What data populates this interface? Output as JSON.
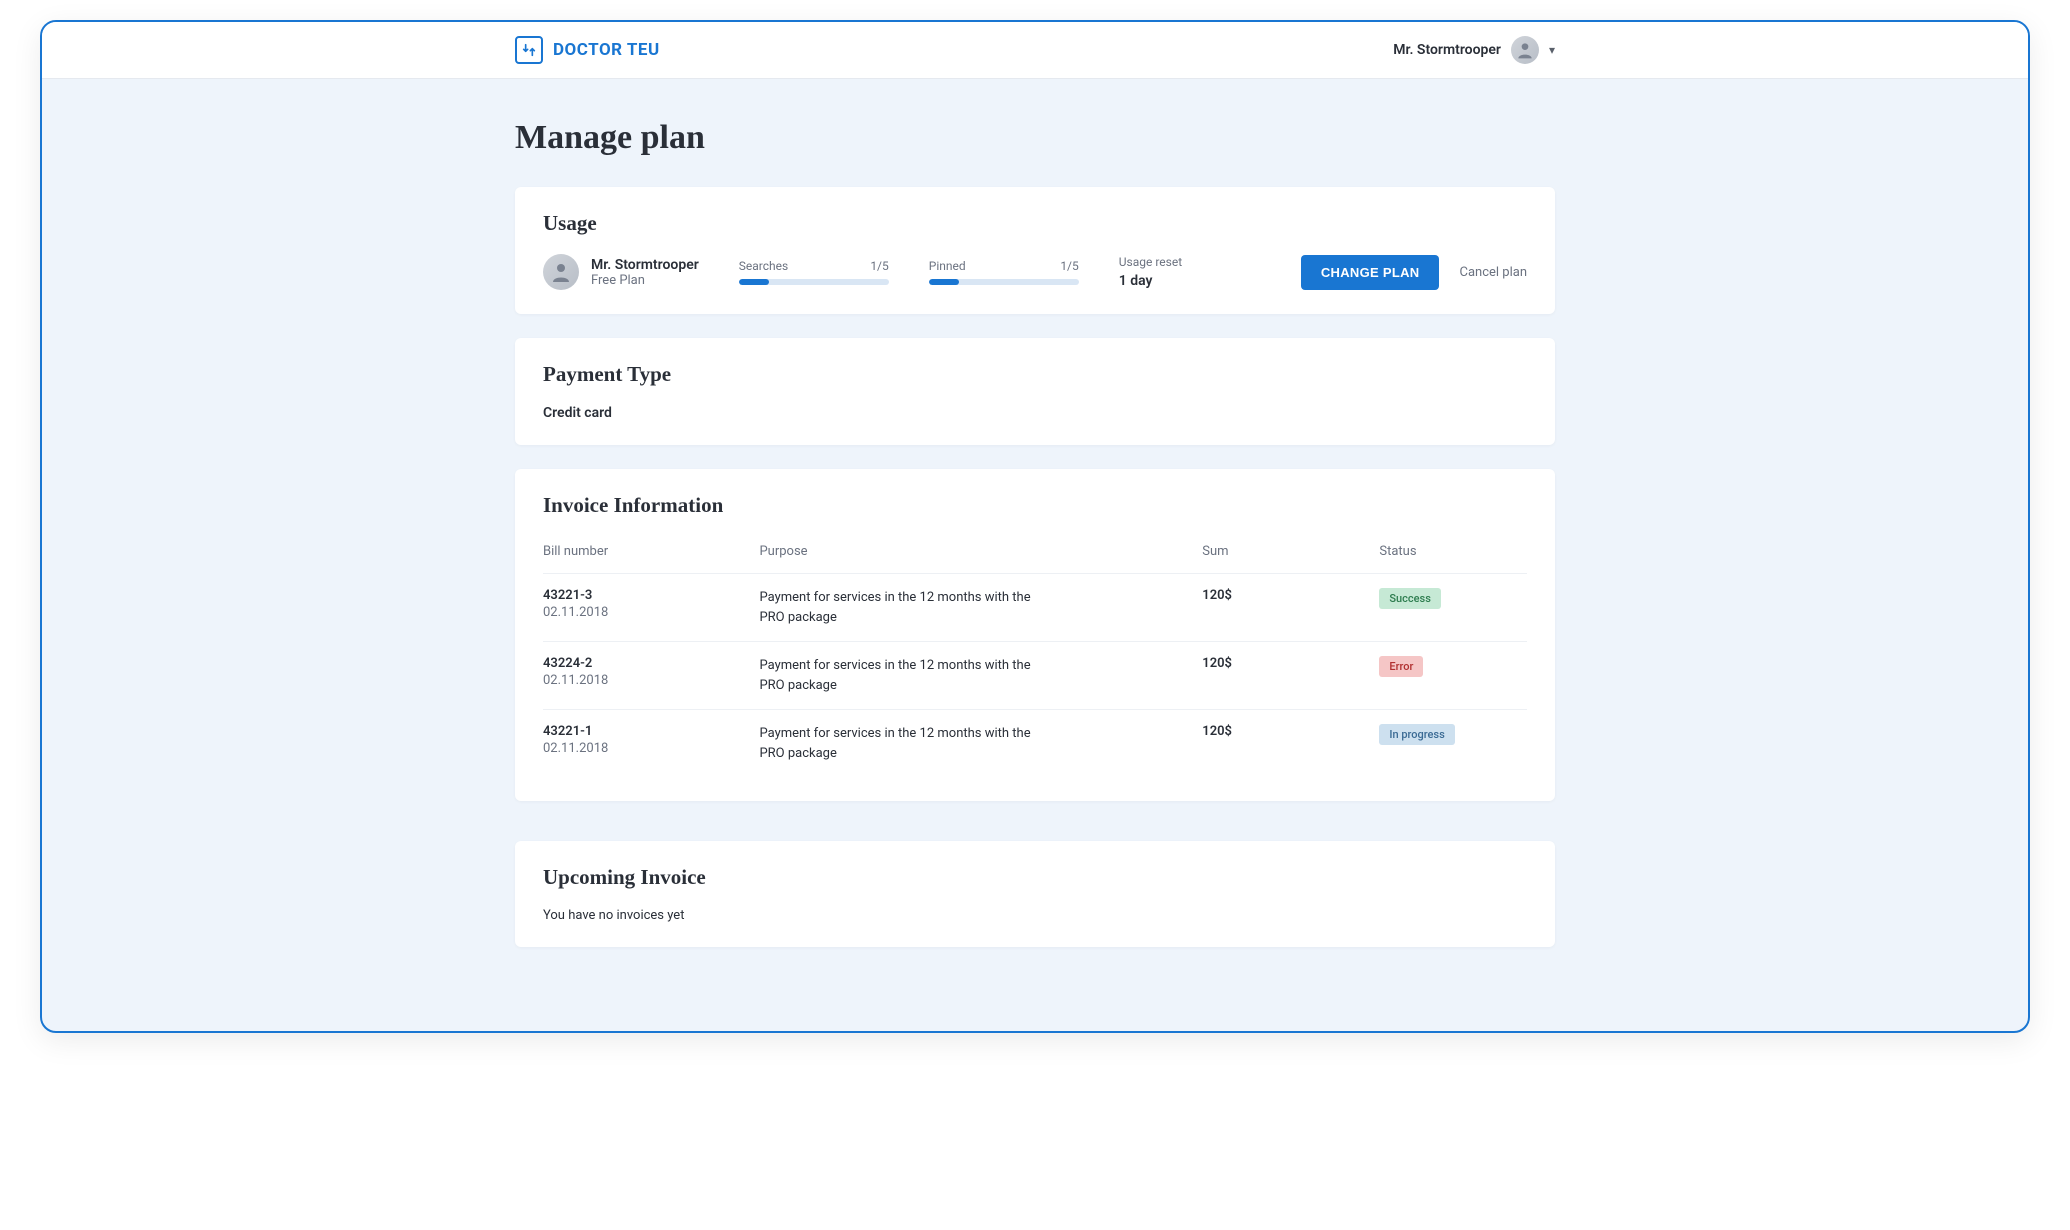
{
  "brand": {
    "name": "DOCTOR TEU"
  },
  "header": {
    "user_name": "Mr. Stormtrooper"
  },
  "page": {
    "title": "Manage plan"
  },
  "usage": {
    "title": "Usage",
    "user": {
      "name": "Mr. Stormtrooper",
      "plan": "Free Plan"
    },
    "stats": [
      {
        "label": "Searches",
        "value": "1/5",
        "percent": 20
      },
      {
        "label": "Pinned",
        "value": "1/5",
        "percent": 20
      }
    ],
    "reset": {
      "label": "Usage reset",
      "value": "1 day"
    },
    "actions": {
      "change_plan": "CHANGE PLAN",
      "cancel_plan": "Cancel plan"
    }
  },
  "payment": {
    "title": "Payment Type",
    "value": "Credit card"
  },
  "invoices": {
    "title": "Invoice Information",
    "columns": {
      "bill": "Bill number",
      "purpose": "Purpose",
      "sum": "Sum",
      "status": "Status"
    },
    "rows": [
      {
        "number": "43221-3",
        "date": "02.11.2018",
        "purpose": "Payment for services in the 12 months with the PRO package",
        "sum": "120$",
        "status": "Success",
        "status_kind": "success"
      },
      {
        "number": "43224-2",
        "date": "02.11.2018",
        "purpose": "Payment for services in the 12 months with the PRO package",
        "sum": "120$",
        "status": "Error",
        "status_kind": "error"
      },
      {
        "number": "43221-1",
        "date": "02.11.2018",
        "purpose": "Payment for services in the 12 months with the PRO package",
        "sum": "120$",
        "status": "In progress",
        "status_kind": "progress"
      }
    ]
  },
  "upcoming": {
    "title": "Upcoming Invoice",
    "empty_text": "You have no invoices yet"
  }
}
